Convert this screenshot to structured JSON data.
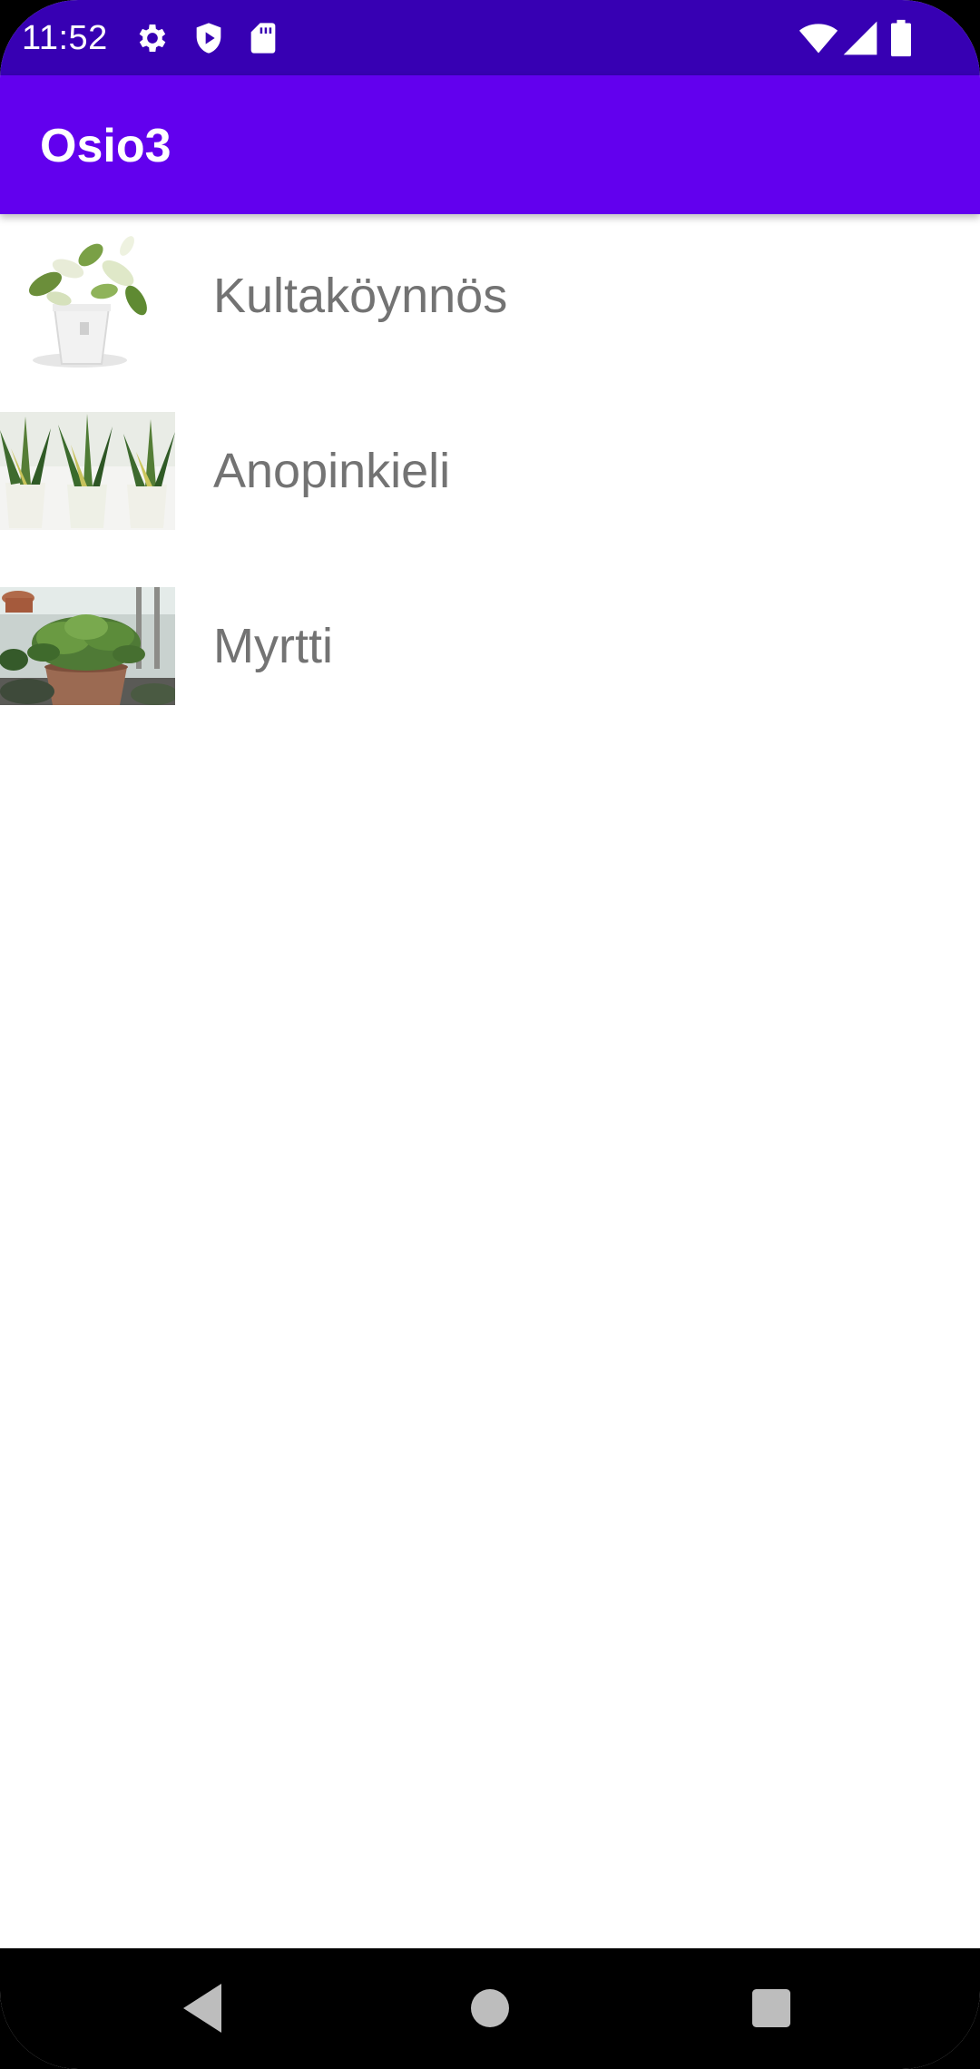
{
  "status_bar": {
    "time": "11:52",
    "icons_left": [
      "gear-icon",
      "shield-play-icon",
      "sd-card-icon"
    ],
    "icons_right": [
      "wifi-icon",
      "cell-signal-icon",
      "battery-icon"
    ],
    "background": "#3700b3"
  },
  "app_bar": {
    "title": "Osio3",
    "background": "#6200ee"
  },
  "list": {
    "items": [
      {
        "label": "Kultaköynnös",
        "image": "pothos-plant-image"
      },
      {
        "label": "Anopinkieli",
        "image": "snake-plant-image"
      },
      {
        "label": "Myrtti",
        "image": "myrtle-plant-image"
      }
    ],
    "label_color": "#737373"
  },
  "nav_bar": {
    "buttons": [
      "back-icon",
      "home-icon",
      "recents-icon"
    ]
  }
}
